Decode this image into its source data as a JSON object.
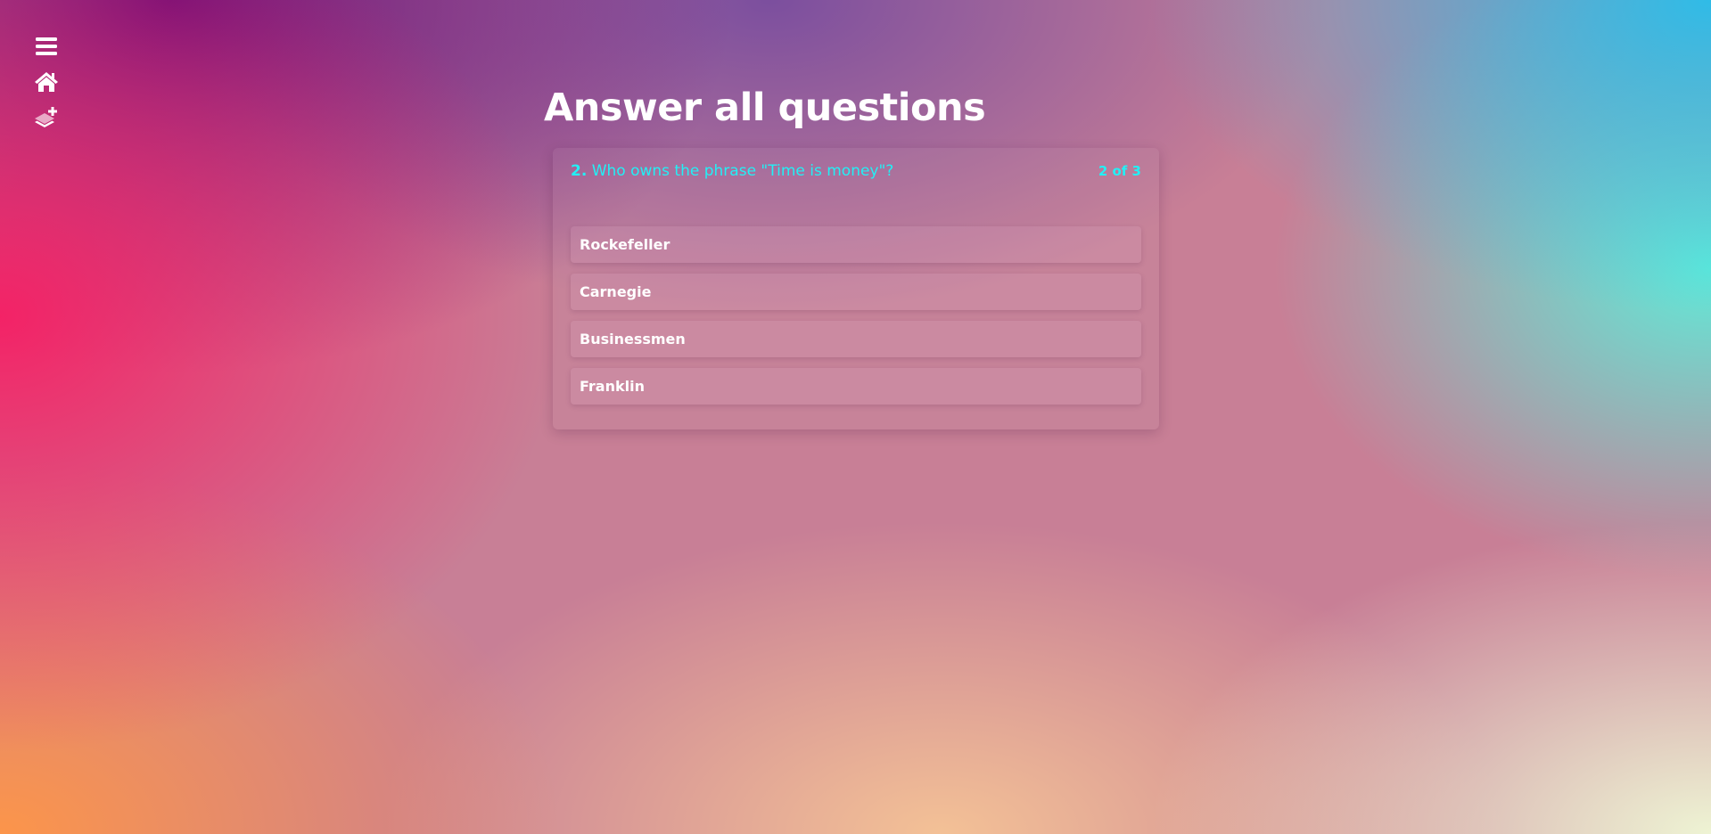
{
  "nav": {
    "icons": [
      "menu-icon",
      "home-icon",
      "add-layer-icon"
    ]
  },
  "page": {
    "title": "Answer all questions"
  },
  "quiz": {
    "question_number": "2.",
    "question_text": "Who owns the phrase \"Time is money\"?",
    "progress": "2 of 3",
    "answers": [
      {
        "label": "Rockefeller"
      },
      {
        "label": "Carnegie"
      },
      {
        "label": "Businessmen"
      },
      {
        "label": "Franklin"
      }
    ]
  },
  "colors": {
    "accent": "#22f0f5",
    "text": "#ffffff"
  }
}
